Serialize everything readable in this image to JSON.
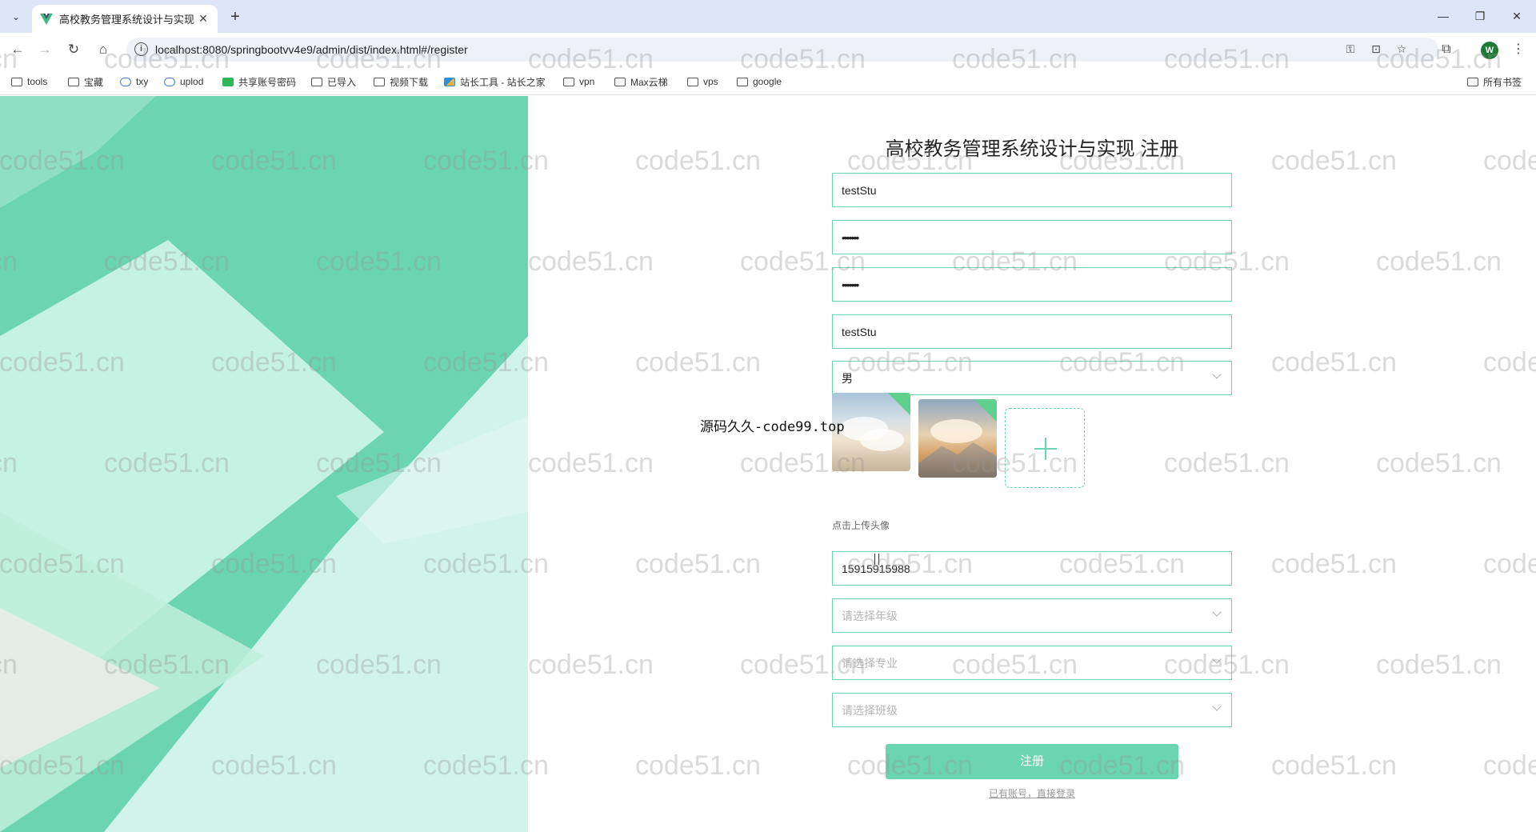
{
  "browser": {
    "tab_title": "高校教务管理系统设计与实现",
    "tab_close": "✕",
    "new_tab": "+",
    "url": "localhost:8080/springbootvv4e9/admin/dist/index.html#/register",
    "profile_initial": "W",
    "bookmarks": [
      "tools",
      "宝藏",
      "txy",
      "uplod",
      "共享账号密码",
      "已导入",
      "视频下载",
      "站长工具 - 站长之家",
      "vpn",
      "Max云梯",
      "vps",
      "google"
    ],
    "all_bookmarks": "所有书签"
  },
  "form": {
    "title": "高校教务管理系统设计与实现 注册",
    "username": "testStu",
    "password": "•••••••",
    "confirm_password": "•••••••",
    "name": "testStu",
    "gender": "男",
    "upload_hint": "点击上传头像",
    "phone": "15915915988",
    "grade_placeholder": "请选择年级",
    "major_placeholder": "请选择专业",
    "class_placeholder": "请选择班级",
    "submit": "注册",
    "login_link": "已有账号，直接登录"
  },
  "overlay_text": "源码久久-code99.top",
  "watermark": "code51.cn",
  "colors": {
    "accent": "#6bd4b1",
    "tabstrip": "#dde6f6"
  }
}
